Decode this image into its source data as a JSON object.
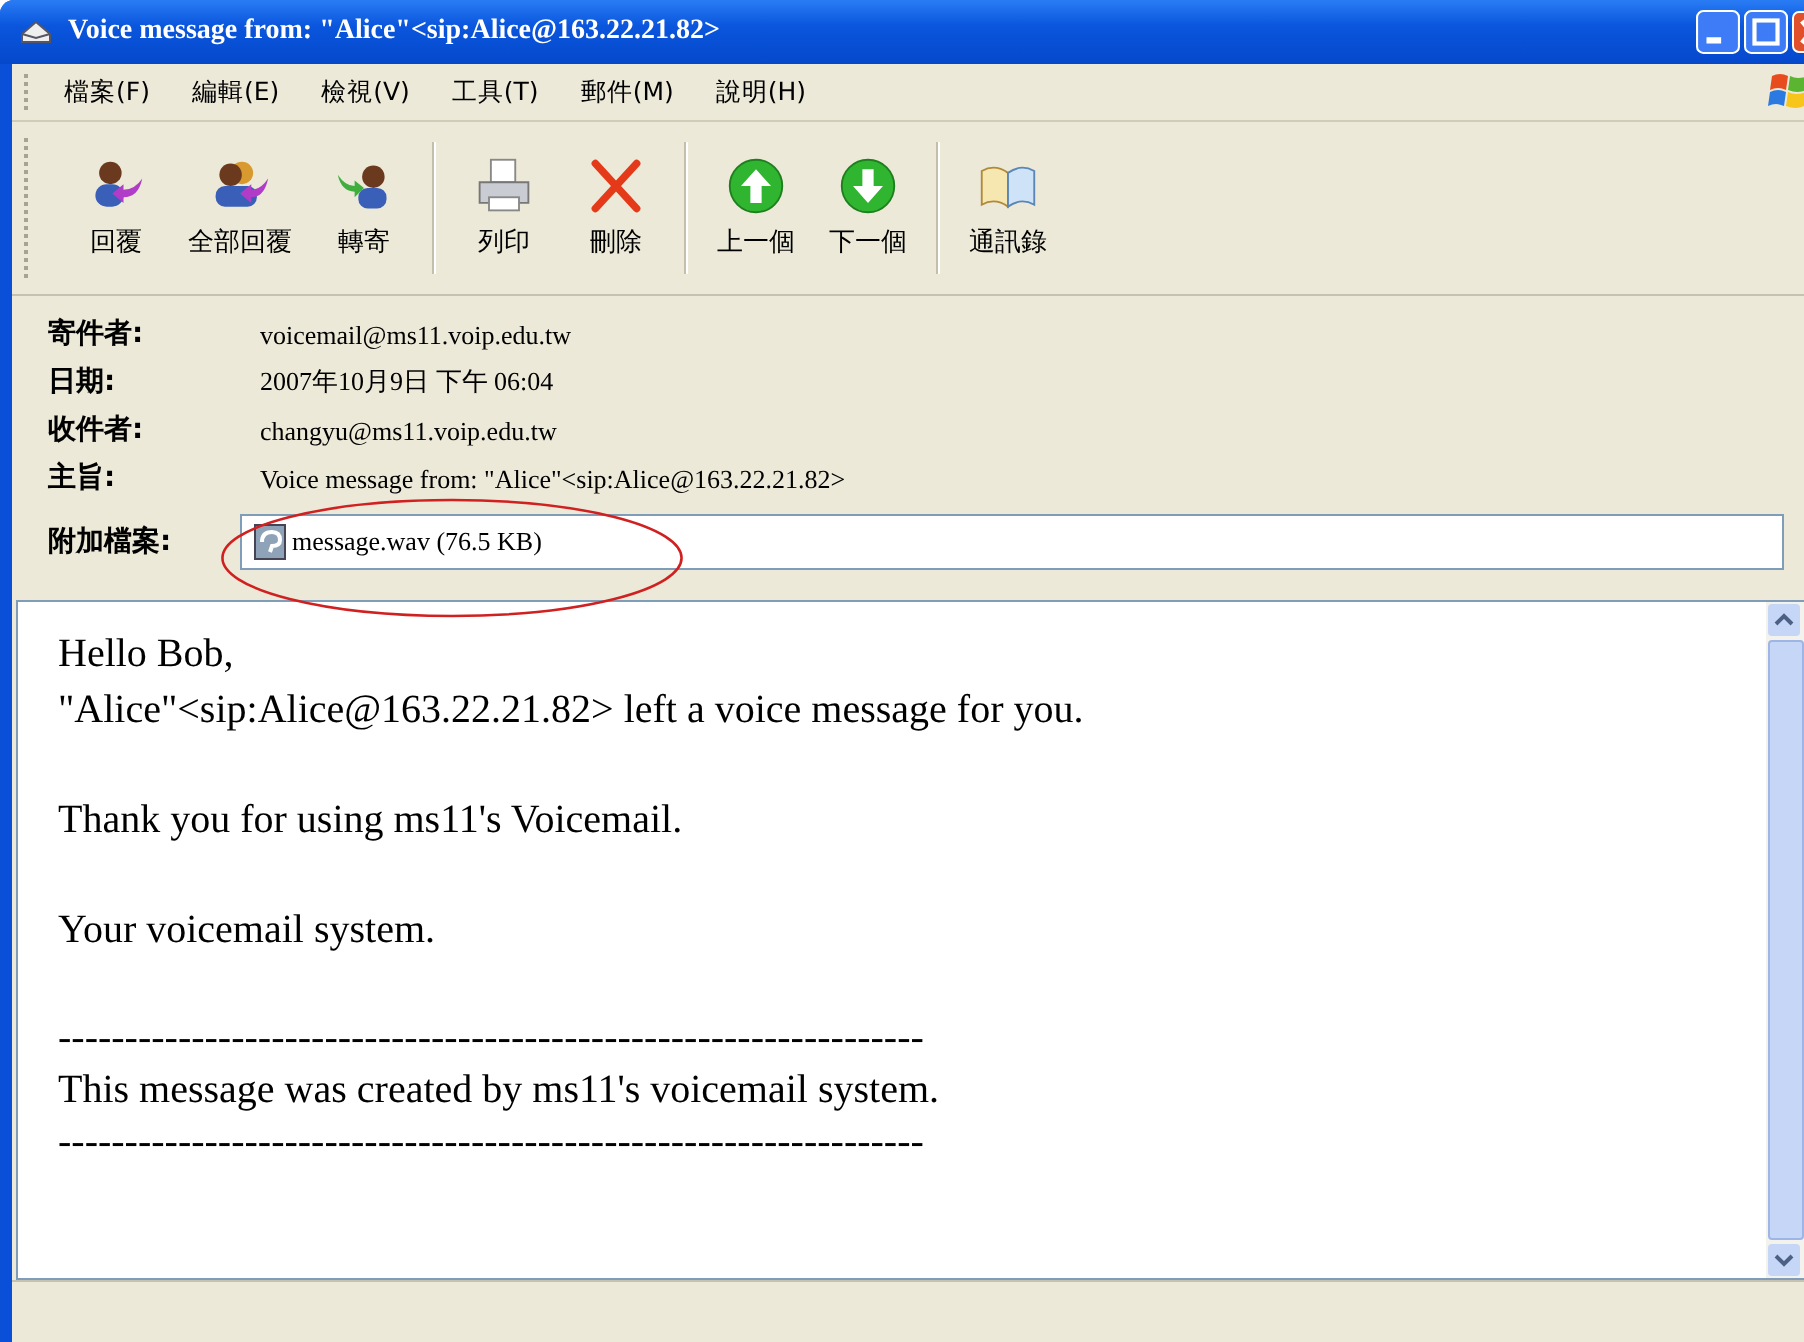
{
  "window": {
    "title": "Voice message from: \"Alice\"<sip:Alice@163.22.21.82>"
  },
  "menu": [
    "檔案(F)",
    "編輯(E)",
    "檢視(V)",
    "工具(T)",
    "郵件(M)",
    "說明(H)"
  ],
  "toolbar": {
    "groups": [
      [
        {
          "label": "回覆",
          "kind": "reply"
        },
        {
          "label": "全部回覆",
          "kind": "reply-all"
        },
        {
          "label": "轉寄",
          "kind": "forward"
        }
      ],
      [
        {
          "label": "列印",
          "kind": "print"
        },
        {
          "label": "刪除",
          "kind": "delete"
        }
      ],
      [
        {
          "label": "上一個",
          "kind": "up"
        },
        {
          "label": "下一個",
          "kind": "down"
        }
      ],
      [
        {
          "label": "通訊錄",
          "kind": "book"
        }
      ]
    ]
  },
  "headers": [
    {
      "label": "寄件者:",
      "value": "voicemail@ms11.voip.edu.tw"
    },
    {
      "label": "日期:",
      "value": "2007年10月9日 下午 06:04"
    },
    {
      "label": "收件者:",
      "value": "changyu@ms11.voip.edu.tw"
    },
    {
      "label": "主旨:",
      "value": " Voice message from: \"Alice\"<sip:Alice@163.22.21.82>"
    }
  ],
  "attachment": {
    "label": "附加檔案:",
    "file": "message.wav (76.5 KB)",
    "highlighted": true
  },
  "body": {
    "blocks": [
      {
        "lines": [
          "Hello Bob,",
          "\"Alice\"<sip:Alice@163.22.21.82> left a voice message for you."
        ]
      },
      {
        "lines": [
          "Thank you for using ms11's Voicemail."
        ]
      },
      {
        "lines": [
          "Your voicemail system."
        ]
      },
      {
        "lines": [
          "-----------------------------------------------------------------",
          "This message was created by ms11's voicemail system.",
          "-----------------------------------------------------------------"
        ]
      }
    ]
  }
}
